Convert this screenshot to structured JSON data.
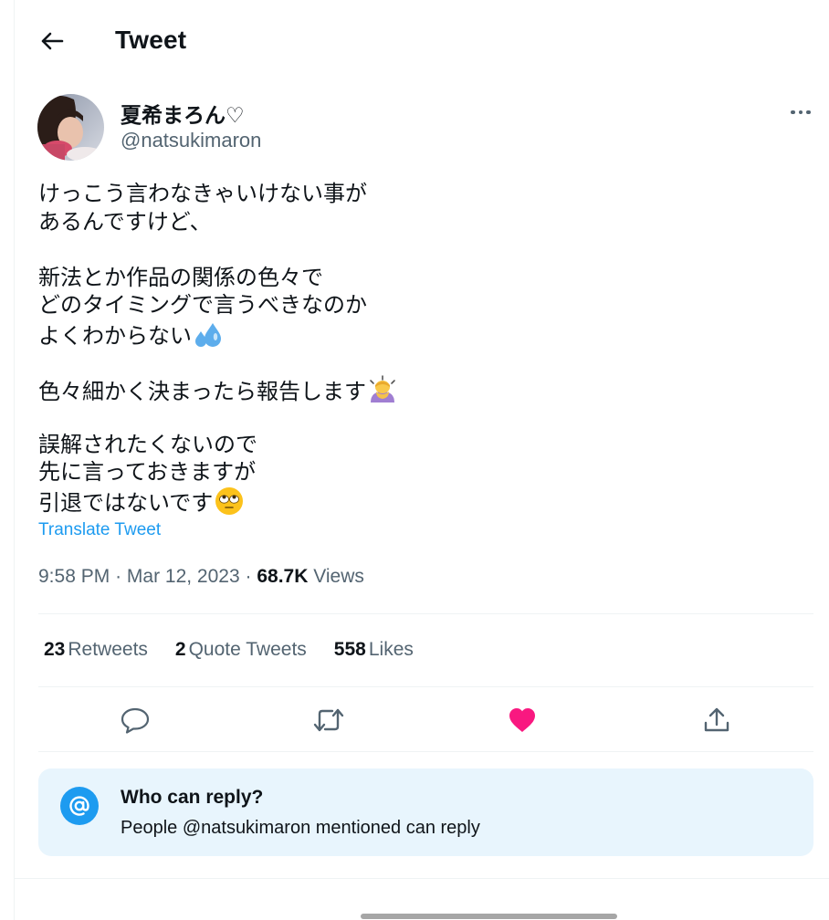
{
  "header": {
    "title": "Tweet",
    "back_icon": "arrow-left-icon"
  },
  "author": {
    "name": "夏希まろん♡",
    "handle": "@natsukimaron",
    "avatar": "profile-photo",
    "more_icon": "more-horizontal-icon"
  },
  "tweet": {
    "lines": {
      "l1": "けっこう言わなきゃいけない事が",
      "l2": "あるんですけど、",
      "l3": "新法とか作品の関係の色々で",
      "l4": "どのタイミングで言うべきなのか",
      "l5": "よくわからない",
      "l6": "色々細かく決まったら報告します",
      "l7": "誤解されたくないので",
      "l8": "先に言っておきますが",
      "l9": "引退ではないです"
    },
    "emojis": [
      "sweat-droplets-emoji",
      "person-bowing-emoji",
      "face-with-rolling-eyes-emoji"
    ],
    "translate_label": "Translate Tweet",
    "time": "9:58 PM",
    "date": "Mar 12, 2023",
    "separator": "·",
    "views_count": "68.7K",
    "views_label": "Views"
  },
  "stats": {
    "retweets_count": "23",
    "retweets_label": "Retweets",
    "quotes_count": "2",
    "quotes_label": "Quote Tweets",
    "likes_count": "558",
    "likes_label": "Likes"
  },
  "actions": [
    "reply-icon",
    "retweet-icon",
    "like-icon",
    "share-icon"
  ],
  "reply_settings": {
    "title": "Who can reply?",
    "description": "People @natsukimaron mentioned can reply",
    "icon": "at-sign-icon"
  },
  "colors": {
    "text": "#0f1419",
    "secondary": "#536471",
    "accent": "#1d9bf0",
    "like": "#f91880",
    "reply_box_bg": "#e8f5fd",
    "divider": "#eff3f4"
  }
}
